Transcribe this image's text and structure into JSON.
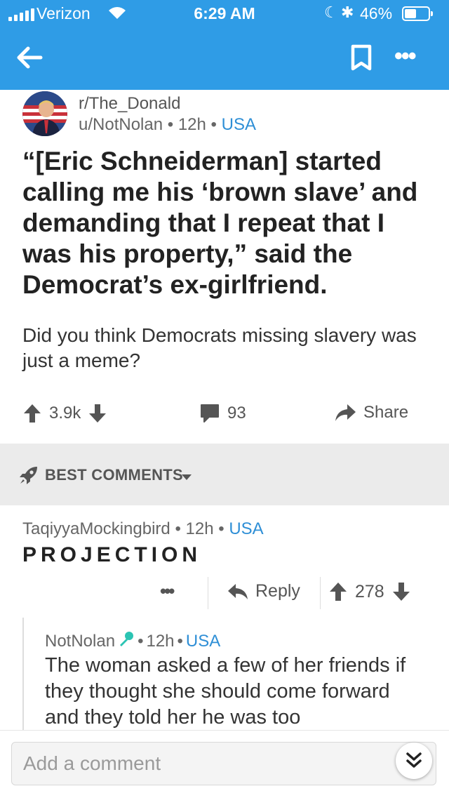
{
  "status_bar": {
    "carrier": "Verizon",
    "time": "6:29 AM",
    "battery": "46%"
  },
  "nav": {
    "back_icon": "arrow-left-icon",
    "save_icon": "bookmark-icon",
    "more_icon": "more-dots-icon"
  },
  "post": {
    "subreddit": "r/The_Donald",
    "author": "u/NotNolan",
    "age": "12h",
    "flair": "USA",
    "title": "“[Eric Schneiderman] started calling me his ‘brown slave’ and demanding that I repeat that I was his property,” said the Democrat’s ex-girlfriend.",
    "body": "Did you think Democrats missing slavery was just a meme?",
    "score": "3.9k",
    "comments": "93",
    "share": "Share"
  },
  "sort": {
    "label": "BEST COMMENTS"
  },
  "comment": {
    "author": "TaqiyyaMockingbird",
    "age": "12h",
    "flair": "USA",
    "body": "PROJECTION",
    "reply": "Reply",
    "score": "278"
  },
  "reply_comment": {
    "author": "NotNolan",
    "age": "12h",
    "flair": "USA",
    "body": "The woman asked a few of her friends if they thought she should come forward and they told her he was too"
  },
  "composer": {
    "placeholder": "Add a comment"
  },
  "colors": {
    "header_blue": "#2f9ce6",
    "flair_blue": "#2f8fd6",
    "mic_teal": "#2bc4b3"
  }
}
